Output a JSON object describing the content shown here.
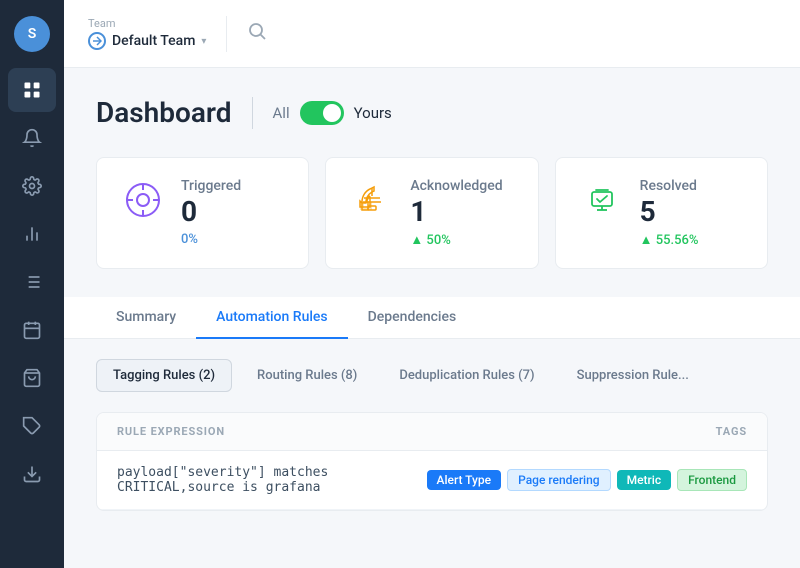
{
  "sidebar": {
    "avatar": "S",
    "items": [
      {
        "id": "dashboard",
        "icon": "grid",
        "active": true
      },
      {
        "id": "alerts",
        "icon": "bell"
      },
      {
        "id": "settings",
        "icon": "gear"
      },
      {
        "id": "analytics",
        "icon": "chart"
      },
      {
        "id": "list",
        "icon": "list"
      },
      {
        "id": "calendar",
        "icon": "calendar"
      },
      {
        "id": "bag",
        "icon": "bag"
      },
      {
        "id": "tag",
        "icon": "tag"
      },
      {
        "id": "download",
        "icon": "download"
      }
    ]
  },
  "header": {
    "team_label": "Team",
    "team_name": "Default Team",
    "search_placeholder": "Search"
  },
  "dashboard": {
    "title": "Dashboard",
    "toggle_all": "All",
    "toggle_yours": "Yours"
  },
  "stats": [
    {
      "id": "triggered",
      "label": "Triggered",
      "value": "0",
      "change": "0%",
      "change_type": "neutral",
      "icon": "target"
    },
    {
      "id": "acknowledged",
      "label": "Acknowledged",
      "value": "1",
      "change": "▲ 50%",
      "change_type": "up",
      "icon": "thumb"
    },
    {
      "id": "resolved",
      "label": "Resolved",
      "value": "5",
      "change": "▲ 55.56%",
      "change_type": "up",
      "icon": "alarm"
    }
  ],
  "tabs": [
    {
      "id": "summary",
      "label": "Summary"
    },
    {
      "id": "automation",
      "label": "Automation Rules",
      "active": true
    },
    {
      "id": "dependencies",
      "label": "Dependencies"
    }
  ],
  "sub_tabs": [
    {
      "id": "tagging",
      "label": "Tagging Rules (2)",
      "active": true
    },
    {
      "id": "routing",
      "label": "Routing Rules (8)"
    },
    {
      "id": "deduplication",
      "label": "Deduplication Rules (7)"
    },
    {
      "id": "suppression",
      "label": "Suppression Rule..."
    }
  ],
  "table": {
    "columns": [
      {
        "id": "rule_expression",
        "label": "RULE EXPRESSION"
      },
      {
        "id": "tags",
        "label": "TAGS"
      }
    ],
    "rows": [
      {
        "rule_expression": "payload[\"severity\"] matches CRITICAL,source is grafana",
        "tags": [
          {
            "label": "Alert Type",
            "type": "blue"
          },
          {
            "label": "Page rendering",
            "type": "light-blue"
          },
          {
            "label": "Metric",
            "type": "teal"
          },
          {
            "label": "Frontend",
            "type": "green"
          }
        ]
      }
    ]
  }
}
